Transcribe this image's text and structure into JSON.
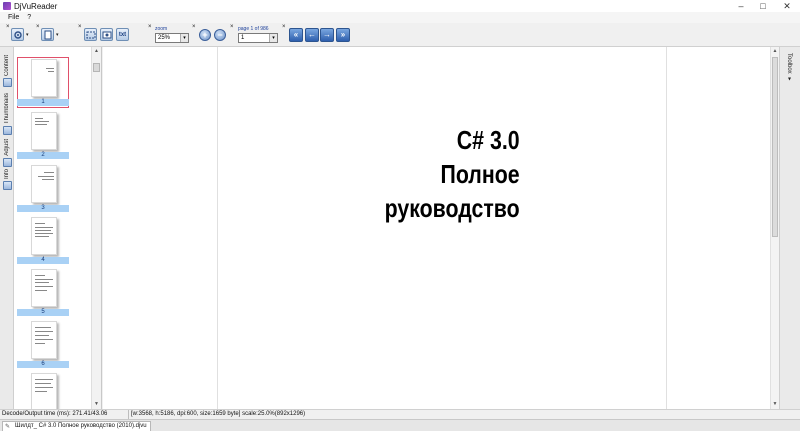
{
  "window": {
    "title": "DjVuReader",
    "minimize": "–",
    "maximize": "□",
    "close": "✕"
  },
  "menu": {
    "items": [
      "File",
      "?"
    ]
  },
  "toolbar": {
    "zoom_label": "zoom",
    "zoom_value": "25%",
    "zoom_in": "+",
    "zoom_out": "−",
    "page_label": "page 1 of 986",
    "page_value": "1",
    "txt_label": "txt",
    "grip": "×",
    "nav_first": "«",
    "nav_prev": "←",
    "nav_next": "→",
    "nav_last": "»",
    "dropdown": "▾"
  },
  "left_tabs": [
    "Content",
    "Thumbnails",
    "Adjust",
    "Info"
  ],
  "thumbnails": [
    {
      "label": "1",
      "selected": true
    },
    {
      "label": "2",
      "selected": false
    },
    {
      "label": "3",
      "selected": false
    },
    {
      "label": "4",
      "selected": false
    },
    {
      "label": "5",
      "selected": false
    },
    {
      "label": "6",
      "selected": false
    },
    {
      "label": "7",
      "selected": false
    }
  ],
  "scroll": {
    "up": "▲",
    "down": "▼"
  },
  "document": {
    "title_lines": [
      "C# 3.0",
      "Полное",
      "руководство"
    ]
  },
  "right_tab": {
    "label": "Toolbox ▾"
  },
  "status": {
    "left": "Decode/Output time (ms): 271.41/43.06",
    "right": "[w:3568, h:5186, dpi:600, size:1659 byte] scale:25.0%(892x1296)"
  },
  "file_tab": {
    "label": "Шилдт_ C# 3.0 Полное руководство (2010).djvu",
    "icon": "✎"
  }
}
